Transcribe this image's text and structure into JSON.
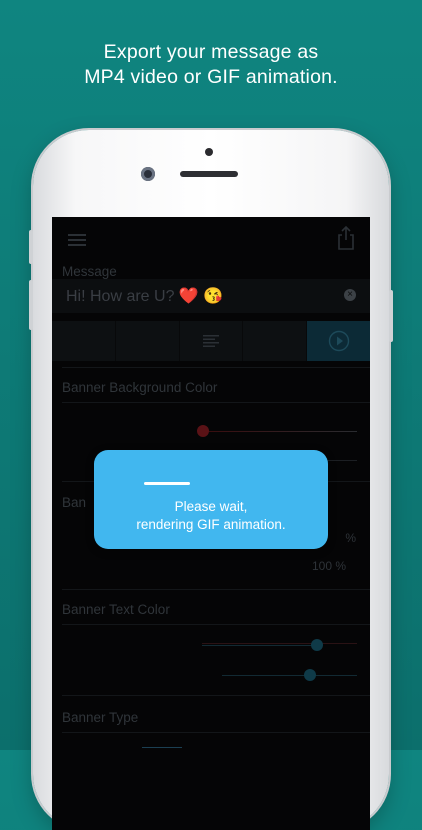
{
  "caption": {
    "line1": "Export your message as",
    "line2": "MP4 video or GIF animation."
  },
  "app": {
    "message_label": "Message",
    "message_text": "Hi! How are U? ❤️ 😘",
    "sections": {
      "background_color": "Banner Background Color",
      "banner_partial": "Ban",
      "text_color": "Banner Text Color",
      "banner_type": "Banner Type"
    },
    "scale_value": "100 %",
    "scale_value_partial": "%"
  },
  "dialog": {
    "line1": "Please wait,",
    "line2": "rendering GIF animation."
  },
  "colors": {
    "background_teal": "#0f8580",
    "dialog_blue": "#41b7ef",
    "screen_dim": "#050506"
  },
  "icons": [
    "menu-icon",
    "share-icon",
    "clear-icon",
    "align-icon",
    "play-icon"
  ]
}
